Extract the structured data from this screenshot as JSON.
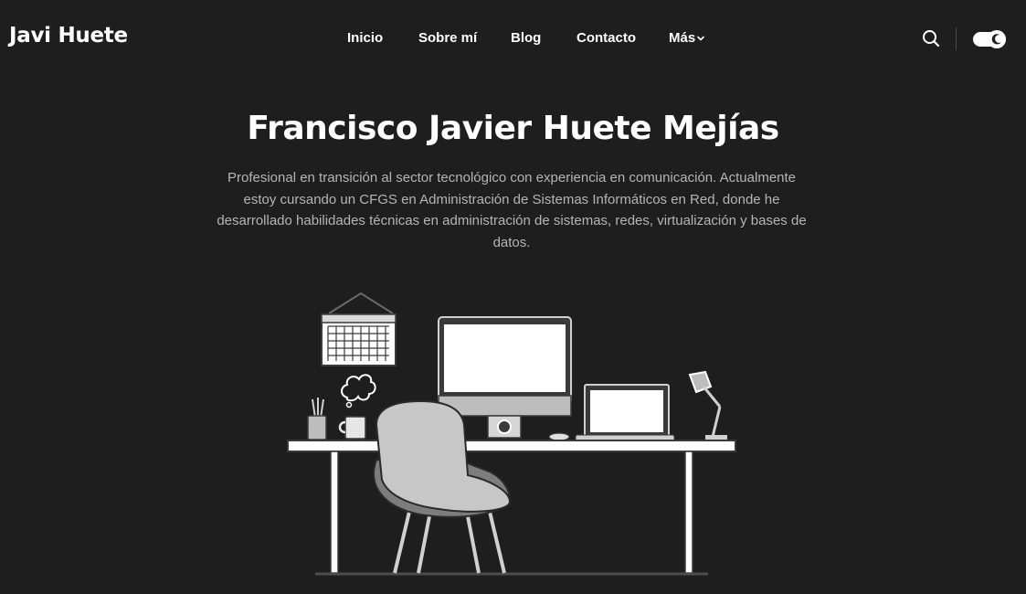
{
  "header": {
    "logo": "Javi Huete",
    "nav": [
      {
        "label": "Inicio"
      },
      {
        "label": "Sobre mí"
      },
      {
        "label": "Blog"
      },
      {
        "label": "Contacto"
      },
      {
        "label": "Más"
      }
    ],
    "icons": {
      "search": "search-icon",
      "theme": "theme-toggle-icon",
      "more": "chevron-down-icon"
    }
  },
  "hero": {
    "title": "Francisco Javier Huete Mejías",
    "description": "Profesional en transición al sector tecnológico con experiencia en comunicación. Actualmente estoy cursando un CFGS en Administración de Sistemas Informáticos en Red, donde he desarrollado habilidades técnicas en administración de sistemas, redes, virtualización y bases de datos."
  },
  "colors": {
    "background": "#1e1e1e",
    "text": "#ffffff",
    "muted_text": "#b5b5b5"
  }
}
